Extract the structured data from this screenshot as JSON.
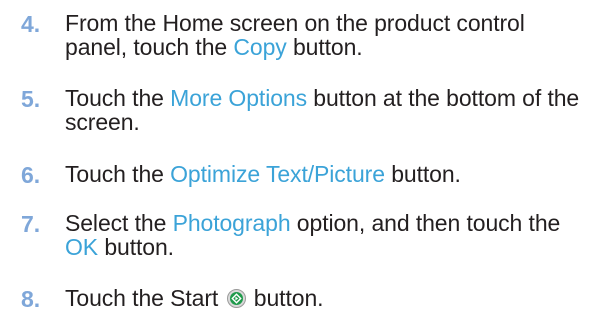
{
  "colors": {
    "step_number": "#7fa7d9",
    "highlight": "#3ba3d8",
    "body_text": "#231f20",
    "start_icon_green": "#1f9a4b"
  },
  "steps": [
    {
      "number": "4.",
      "pre": "From the Home screen on the product control panel, touch the ",
      "term": "Copy",
      "post": " button."
    },
    {
      "number": "5.",
      "pre": "Touch the ",
      "term": "More Options",
      "post": " button at the bottom of the screen."
    },
    {
      "number": "6.",
      "pre": "Touch the ",
      "term": "Optimize Text/Picture",
      "post": " button."
    },
    {
      "number": "7.",
      "pre": "Select the ",
      "term": "Photograph",
      "mid": " option, and then touch the ",
      "term2": "OK",
      "post": " button."
    },
    {
      "number": "8.",
      "pre": "Touch the Start",
      "icon": "start-button-icon",
      "post": "button."
    }
  ]
}
